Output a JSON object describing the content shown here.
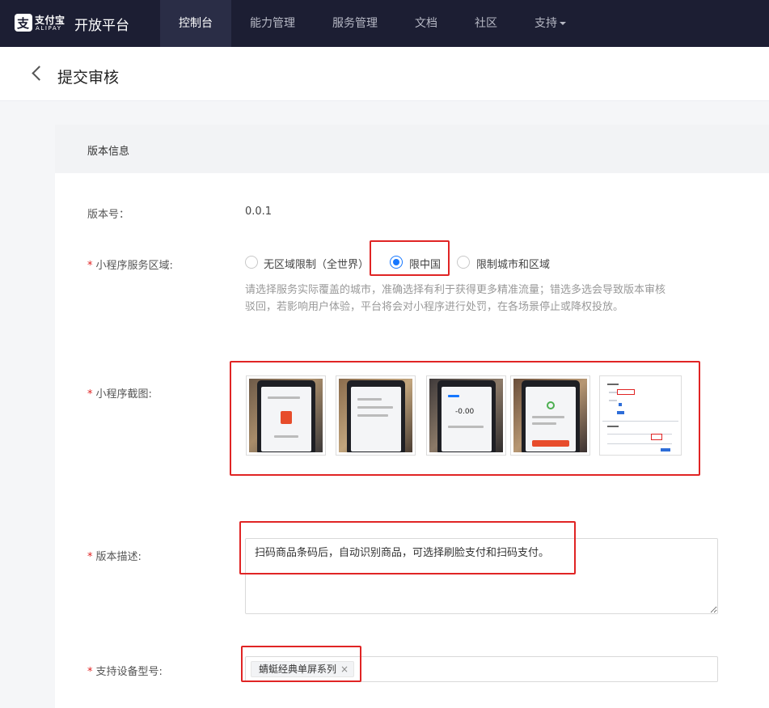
{
  "nav": {
    "brand_cn": "支付宝",
    "brand_en": "ALIPAY",
    "platform": "开放平台",
    "items": [
      {
        "label": "控制台",
        "active": true
      },
      {
        "label": "能力管理",
        "active": false
      },
      {
        "label": "服务管理",
        "active": false
      },
      {
        "label": "文档",
        "active": false
      },
      {
        "label": "社区",
        "active": false
      },
      {
        "label": "支持",
        "active": false,
        "dropdown": true
      }
    ]
  },
  "header": {
    "title": "提交审核",
    "back_icon": "chevron-left-icon"
  },
  "section": {
    "title": "版本信息"
  },
  "form": {
    "version": {
      "label": "版本号：",
      "value": "0.0.1"
    },
    "region": {
      "label": "小程序服务区域:",
      "options": [
        {
          "label": "无区域限制（全世界）",
          "checked": false
        },
        {
          "label": "限中国",
          "checked": true
        },
        {
          "label": "限制城市和区域",
          "checked": false
        }
      ],
      "hint": "请选择服务实际覆盖的城市，准确选择有利于获得更多精准流量；错选多选会导致版本审核驳回，若影响用户体验，平台将会对小程序进行处罚，在各场景停止或降权投放。"
    },
    "screenshots": {
      "label": "小程序截图:",
      "items": [
        {
          "name": "screenshot-1",
          "screen_amount": ""
        },
        {
          "name": "screenshot-2",
          "screen_amount": ""
        },
        {
          "name": "screenshot-3",
          "screen_amount": "-0.00"
        },
        {
          "name": "screenshot-4",
          "screen_amount": ""
        },
        {
          "name": "screenshot-5",
          "screen_amount": ""
        }
      ]
    },
    "description": {
      "label": "版本描述:",
      "value": "扫码商品条码后，自动识别商品，可选择刷脸支付和扫码支付。"
    },
    "devices": {
      "label": "支持设备型号:",
      "tags": [
        "蜻蜓经典单屏系列"
      ]
    }
  },
  "colors": {
    "nav_bg": "#1c1e33",
    "accent": "#1677ff",
    "required": "#e02020",
    "highlight": "#e02424"
  }
}
